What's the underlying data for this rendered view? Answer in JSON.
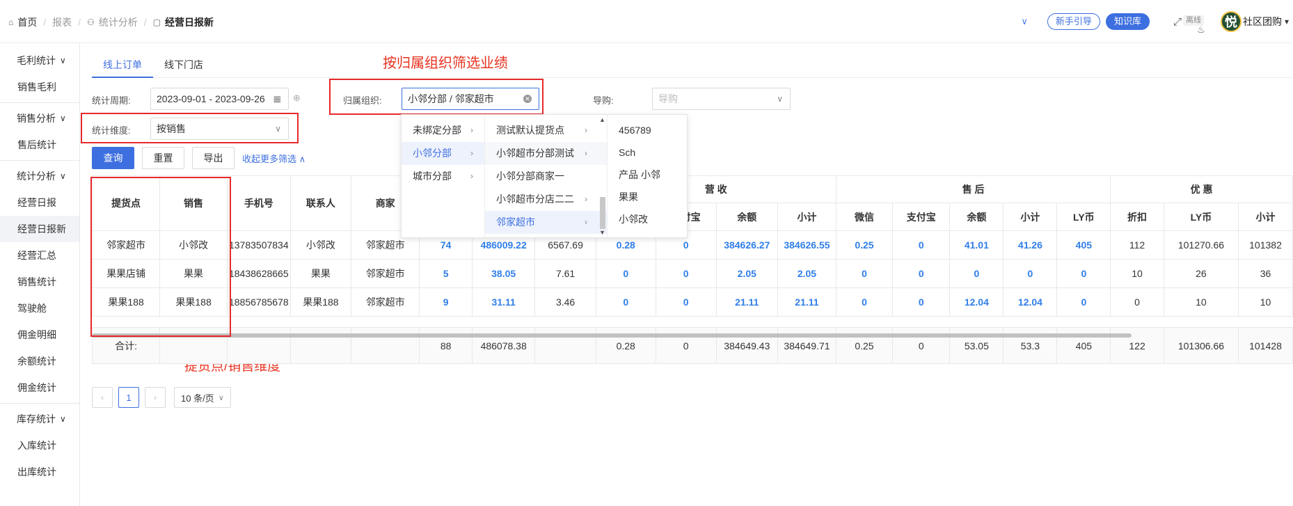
{
  "breadcrumb": [
    "首页",
    "报表",
    "统计分析",
    "经营日报新"
  ],
  "topbar": {
    "guide_label": "新手引导",
    "knowledge_label": "知识库",
    "offline_label": "离线",
    "avatar_char": "悦",
    "user_name": "社区团购",
    "accent": "#3d6fe0"
  },
  "sidebar": {
    "groups": [
      {
        "label": "毛利统计",
        "items": [
          "销售毛利"
        ]
      },
      {
        "label": "销售分析",
        "items": [
          "售后统计"
        ]
      },
      {
        "label": "统计分析",
        "items": [
          "经营日报",
          "经营日报新",
          "经营汇总",
          "销售统计",
          "驾驶舱",
          "佣金明细",
          "余额统计",
          "佣金统计"
        ]
      },
      {
        "label": "库存统计",
        "items": [
          "入库统计",
          "出库统计"
        ]
      }
    ]
  },
  "tabs": [
    "线上订单",
    "线下门店"
  ],
  "annotations": {
    "org_filter": "按归属组织筛选业绩",
    "dimension": "提货点/销售维度"
  },
  "filters": {
    "period_label": "统计周期:",
    "period_value": "2023-09-01 - 2023-09-26",
    "org_label": "归属组织:",
    "org_value": "小邻分部 / 邻家超市",
    "guide_label": "导购:",
    "guide_placeholder": "导购",
    "dimension_label": "统计维度:",
    "dimension_value": "按销售"
  },
  "actions": {
    "query": "查询",
    "reset": "重置",
    "export": "导出",
    "collapse": "收起更多筛选"
  },
  "cascader": {
    "col1": [
      "未绑定分部",
      "小邻分部",
      "城市分部"
    ],
    "col2": [
      "测试默认提货点",
      "小邻超市分部测试",
      "小邻分部商家一",
      "小邻超市分店二二",
      "邻家超市"
    ],
    "col3": [
      "456789",
      "Sch",
      "产品 小邻",
      "果果",
      "小邻改"
    ]
  },
  "table": {
    "group_headers": {
      "revenue": "营 收",
      "after_sale": "售 后",
      "discount": "优 惠"
    },
    "headers": {
      "pickup": "提货点",
      "sales": "销售",
      "phone": "手机号",
      "contact": "联系人",
      "merchant": "商家",
      "rev_alipay": "支付宝",
      "rev_balance": "余额",
      "rev_subtotal": "小计",
      "as_wechat": "微信",
      "as_alipay": "支付宝",
      "as_balance": "余额",
      "as_subtotal": "小计",
      "as_ly": "LY币",
      "d_discount": "折扣",
      "d_ly": "LY币",
      "d_subtotal": "小计"
    },
    "rows": [
      [
        "邻家超市",
        "小邻改",
        "13783507834",
        "小邻改",
        "邻家超市",
        "74",
        "486009.22",
        "6567.69",
        "0.28",
        "0",
        "384626.27",
        "384626.55",
        "0.25",
        "0",
        "41.01",
        "41.26",
        "405",
        "112",
        "101270.66",
        "101382"
      ],
      [
        "果果店铺",
        "果果",
        "18438628665",
        "果果",
        "邻家超市",
        "5",
        "38.05",
        "7.61",
        "0",
        "0",
        "2.05",
        "2.05",
        "0",
        "0",
        "0",
        "0",
        "0",
        "10",
        "26",
        "36"
      ],
      [
        "果果188",
        "果果188",
        "18856785678",
        "果果188",
        "邻家超市",
        "9",
        "31.11",
        "3.46",
        "0",
        "0",
        "21.11",
        "21.11",
        "0",
        "0",
        "12.04",
        "12.04",
        "0",
        "0",
        "10",
        "10"
      ]
    ],
    "totals_label": "合计:",
    "totals": [
      "88",
      "486078.38",
      "",
      "0.28",
      "0",
      "384649.43",
      "384649.71",
      "0.25",
      "0",
      "53.05",
      "53.3",
      "405",
      "122",
      "101306.66",
      "101428"
    ]
  },
  "pagination": {
    "current": "1",
    "page_size": "10 条/页"
  }
}
